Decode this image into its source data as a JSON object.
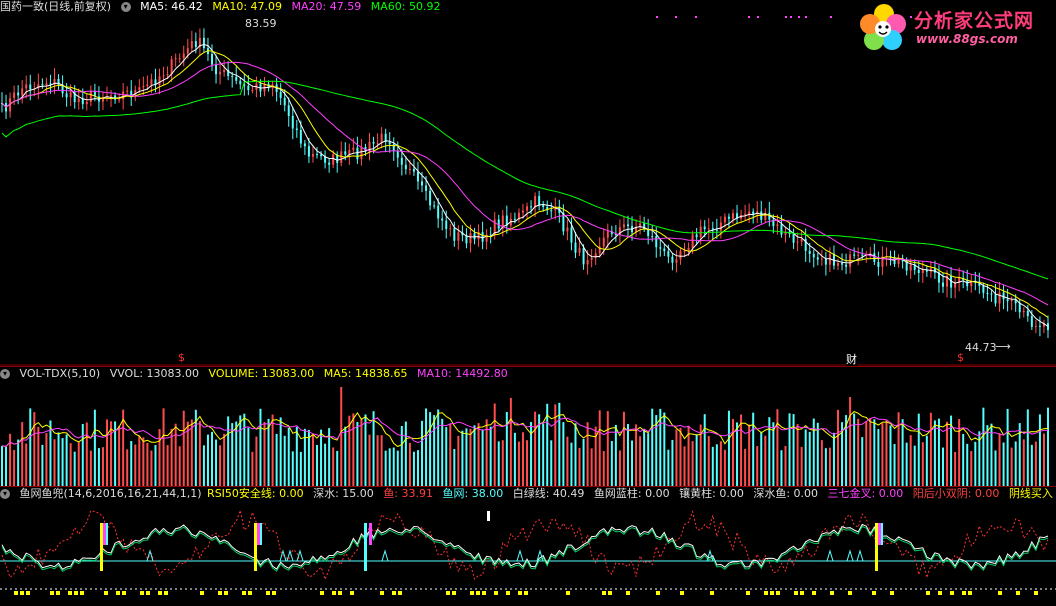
{
  "price_header": {
    "stock_title": "国药一致(日线,前复权)",
    "ma5": "MA5: 46.42",
    "ma10": "MA10: 47.09",
    "ma20": "MA20: 47.59",
    "ma60": "MA60: 50.92"
  },
  "price_annotations": {
    "high_label": "83.59",
    "low_label": "44.73",
    "cai_marker": "财",
    "s_marker_1": "$",
    "s_marker_2": "$"
  },
  "logo": {
    "title": "分析家公式网",
    "url": "www.88gs.com"
  },
  "volume_header": {
    "name": "VOL-TDX(5,10)",
    "vvol": "VVOL: 13083.00",
    "volume": "VOLUME: 13083.00",
    "ma5": "MA5: 14838.65",
    "ma10": "MA10: 14492.80"
  },
  "indicator_header": {
    "name": "鱼网鱼兜(14,6,2016,16,21,44,1,1)",
    "rsi50": "RSI50安全线: 0.00",
    "shenshui": "深水: 15.00",
    "yu": "鱼: 33.91",
    "yuwang": "鱼网: 38.00",
    "baiLv": "白绿线: 40.49",
    "yuwang_blue": "鱼网蓝柱: 0.00",
    "xiang_huang": "镶黄柱: 0.00",
    "shenshui_yu": "深水鱼: 0.00",
    "sanqi": "三七金叉: 0.00",
    "yanghou": "阳后小双阴: 0.00",
    "yinxian": "阴线买入"
  },
  "colors": {
    "ma5": "#ffffff",
    "ma10": "#ffff00",
    "ma20": "#ff00ff",
    "ma60": "#00ff00",
    "up": "#ff4d4d",
    "down": "#54ffff",
    "grid": "#8a0000"
  },
  "chart_data": {
    "type": "line",
    "title": "国药一致(日线,前复权)",
    "series": [
      {
        "name": "MA5",
        "values": []
      },
      {
        "name": "MA10",
        "values": []
      },
      {
        "name": "MA20",
        "values": []
      },
      {
        "name": "MA60",
        "values": []
      }
    ],
    "highest": 83.59,
    "lowest": 44.73
  }
}
